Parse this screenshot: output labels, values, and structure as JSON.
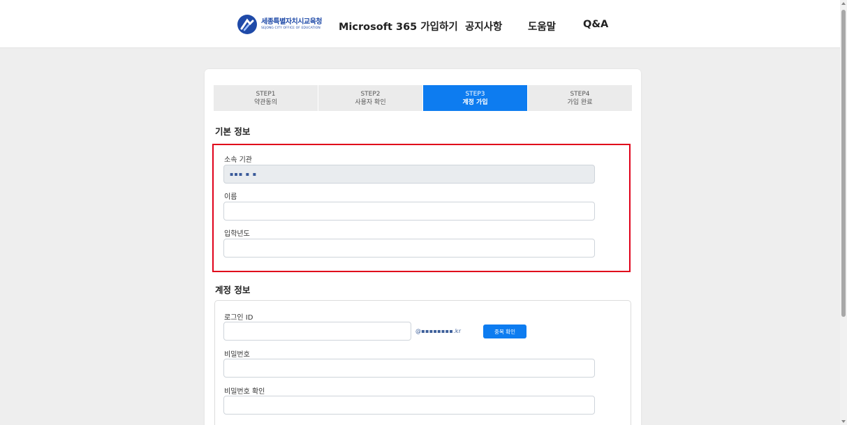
{
  "header": {
    "logo_ko": "세종특별자치시교육청",
    "logo_en": "SEJONG CITY OFFICE OF EDUCATION",
    "nav": [
      "Microsoft 365 가입하기",
      "공지사항",
      "도움말",
      "Q&A"
    ]
  },
  "steps": [
    {
      "num": "STEP1",
      "label": "약관동의",
      "active": false
    },
    {
      "num": "STEP2",
      "label": "사용자 확인",
      "active": false
    },
    {
      "num": "STEP3",
      "label": "계정 가입",
      "active": true
    },
    {
      "num": "STEP4",
      "label": "가입 완료",
      "active": false
    }
  ],
  "basic_info": {
    "title": "기본 정보",
    "org_label": "소속 기관",
    "org_value": "▪▪▪ ▪ ▪",
    "name_label": "이름",
    "name_value": "",
    "year_label": "입학년도",
    "year_value": ""
  },
  "account_info": {
    "title": "계정 정보",
    "login_label": "로그인 ID",
    "login_value": "",
    "domain": "@▪▪▪▪▪▪▪▪.kr",
    "dup_button": "중복 확인",
    "pw_label": "비밀번호",
    "pw_confirm_label": "비밀번호 확인"
  },
  "colors": {
    "accent": "#0d7cf0",
    "highlight": "#e0001a",
    "brand": "#1f4aa8"
  }
}
